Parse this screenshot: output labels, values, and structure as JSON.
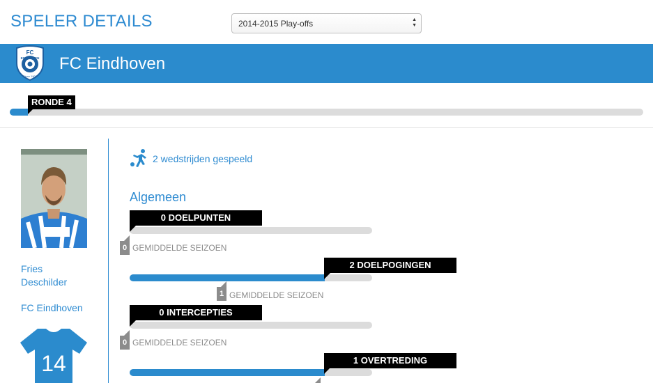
{
  "header": {
    "title": "SPELER DETAILS"
  },
  "season_select": {
    "selected": "2014-2015 Play-offs"
  },
  "club": {
    "name": "FC Eindhoven",
    "logo_text_top": "FC",
    "logo_text_mid": "EINDHOVEN",
    "logo_text_bottom": "Since 1909",
    "color": "#2b8bcd"
  },
  "round": {
    "label": "RONDE 4",
    "progress_fraction": 0.03
  },
  "player": {
    "first_name": "Fries",
    "last_name": "Deschilder",
    "club": "FC Eindhoven",
    "shirt_number": "14",
    "shirt_color": "#2b8bcd"
  },
  "matches": {
    "text": "2 wedstrijden gespeeld",
    "icon": "football-player-icon"
  },
  "sections": {
    "general": {
      "title": "Algemeen",
      "stats": [
        {
          "label": "0 DOELPUNTEN",
          "value": 0,
          "average_value": "0",
          "average_text": "GEMIDDELDE SEIZOEN"
        },
        {
          "label": "2 DOELPOGINGEN",
          "value": 2,
          "average_value": "1",
          "average_text": "GEMIDDELDE SEIZOEN"
        },
        {
          "label": "0 INTERCEPTIES",
          "value": 0,
          "average_value": "0",
          "average_text": "GEMIDDELDE SEIZOEN"
        },
        {
          "label": "1 OVERTREDING",
          "value": 1,
          "average_value": "",
          "average_text": ""
        }
      ]
    }
  }
}
